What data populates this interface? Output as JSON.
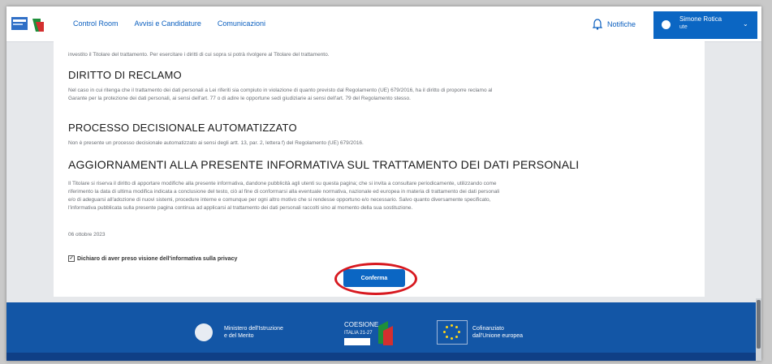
{
  "header": {
    "nav": [
      "Control Room",
      "Avvisi e Candidature",
      "Comunicazioni"
    ],
    "notifications_label": "Notifiche",
    "user": {
      "name": "Simone Rotica",
      "role": "ute"
    }
  },
  "content": {
    "intro_line": "investito il Titolare del trattamento. Per esercitare i diritti di cui sopra si potrà rivolgere al Titolare del trattamento.",
    "sections": [
      {
        "title": "DIRITTO DI RECLAMO",
        "lines": [
          "Nel caso in cui ritenga che il trattamento dei dati personali a Lei riferiti sia compiuto in violazione di quanto previsto dal Regolamento (UE) 679/2016, ha il diritto di proporre reclamo al",
          "Garante per la protezione dei dati personali, ai sensi dell'art. 77 o di adire le opportune sedi giudiziarie ai sensi dell'art. 79 del Regolamento stesso."
        ]
      },
      {
        "title": "PROCESSO DECISIONALE AUTOMATIZZATO",
        "lines": [
          "Non è presente un processo decisionale automatizzato ai sensi degli artt. 13, par. 2, lettera f) del Regolamento (UE) 679/2016."
        ]
      },
      {
        "title": "AGGIORNAMENTI ALLA PRESENTE INFORMATIVA SUL TRATTAMENTO DEI DATI PERSONALI",
        "lines": [
          "Il Titolare si riserva il diritto di apportare modifiche alla presente informativa, dandone pubblicità agli utenti su questa pagina; che si invita a consultare periodicamente, utilizzando come",
          "riferimento la data di ultima modifica indicata a conclusione del testo, ciò al fine di conformarsi alla eventuale normativa, nazionale ed europea in materia di trattamento dei dati personali",
          "e/o di adeguarsi all'adozione di nuovi sistemi, procedure interne e comunque per ogni altro motivo che si rendesse opportuno e/o necessario. Salvo quanto diversamente specificato,",
          "l'informativa pubblicata sulla presente pagina continua ad applicarsi al trattamento dei dati personali raccolti sino al momento della sua sostituzione."
        ]
      }
    ],
    "date": "06 ottobre 2023",
    "checkbox_label": "Dichiaro di aver preso visione dell'informativa sulla privacy",
    "confirm_label": "Conferma"
  },
  "footer": {
    "ministry": [
      "Ministero dell'Istruzione",
      "e del Merito"
    ],
    "coesione": [
      "COESIONE",
      "ITALIA 21-27"
    ],
    "eu": [
      "Cofinanziato",
      "dall'Unione europea"
    ]
  },
  "colors": {
    "primary": "#0b66c3",
    "link": "#0b5fbf",
    "footer": "#1356a6",
    "highlight_ring": "#d71920"
  }
}
